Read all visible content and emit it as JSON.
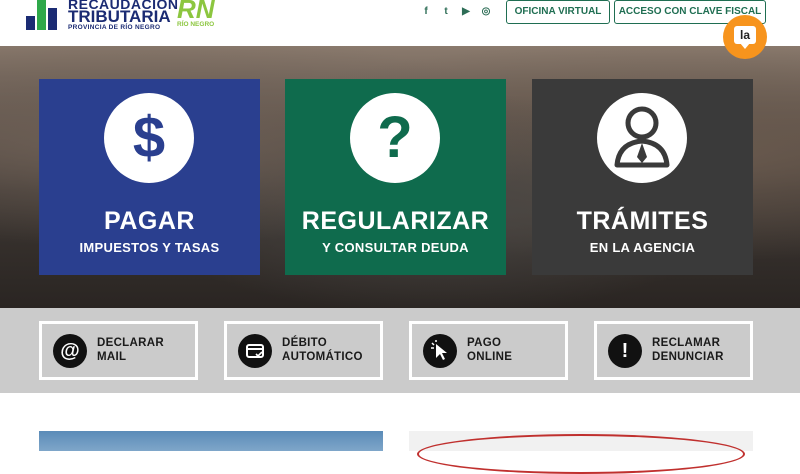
{
  "header": {
    "logo_line1": "RECAUDACIÓN",
    "logo_line2": "TRIBUTARIA",
    "logo_line3": "PROVINCIA DE RÍO NEGRO",
    "rn_mark": "RN",
    "rn_label": "RÍO NEGRO",
    "social": {
      "facebook": "f",
      "twitter": "t",
      "youtube": "▶",
      "instagram": "◎"
    },
    "buttons": {
      "oficina_virtual": "OFICINA VIRTUAL",
      "clave_fiscal": "ACCESO CON CLAVE FISCAL"
    },
    "chat_label": "la"
  },
  "cards": [
    {
      "glyph": "$",
      "title": "PAGAR",
      "subtitle": "IMPUESTOS Y TASAS",
      "color": "#2a3f8f"
    },
    {
      "glyph": "?",
      "title": "REGULARIZAR",
      "subtitle": "Y CONSULTAR DEUDA",
      "color": "#0f6b4d"
    },
    {
      "glyph": "",
      "title": "TRÁMITES",
      "subtitle": "EN LA AGENCIA",
      "color": "#3a3a3a"
    }
  ],
  "quick_links": [
    {
      "icon": "@",
      "line1": "DECLARAR",
      "line2": "MAIL"
    },
    {
      "icon": "",
      "line1": "DÉBITO",
      "line2": "AUTOMÁTICO"
    },
    {
      "icon": "",
      "line1": "PAGO",
      "line2": "ONLINE"
    },
    {
      "icon": "!",
      "line1": "RECLAMAR",
      "line2": "DENUNCIAR"
    }
  ],
  "colors": {
    "accent_green": "#1f6e52",
    "chat_orange": "#f7941d",
    "band_gray": "#cbcbcb"
  }
}
